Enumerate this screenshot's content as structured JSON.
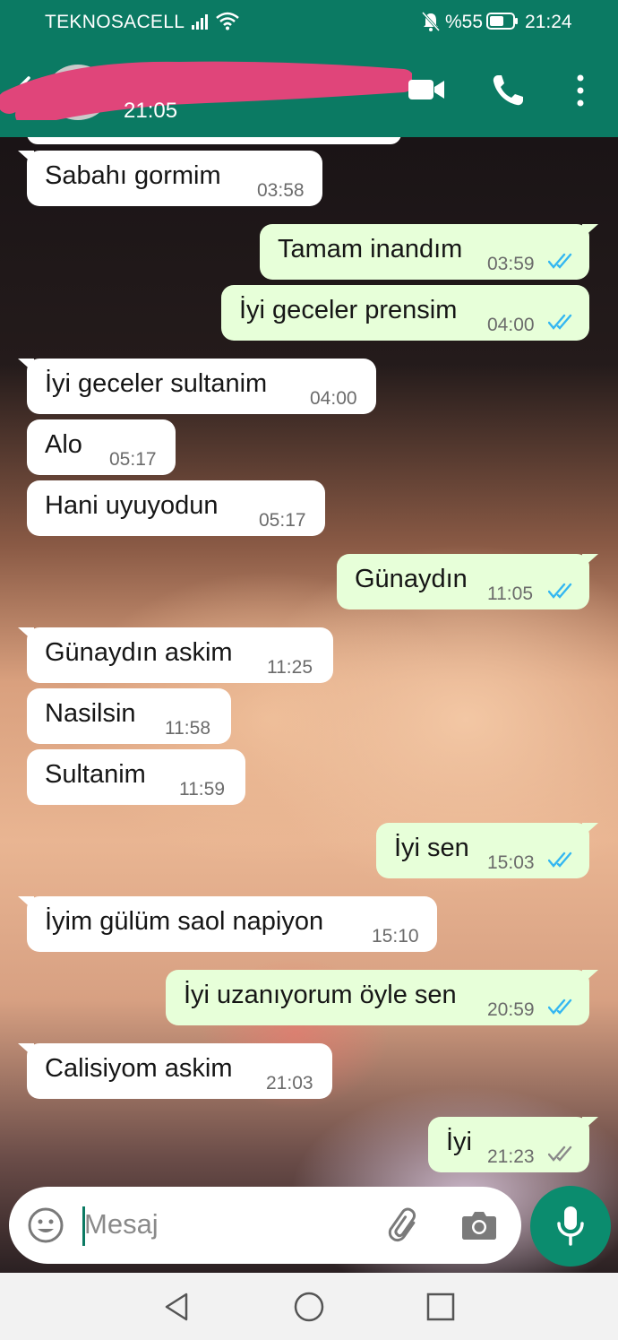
{
  "status_bar": {
    "carrier": "TEKNOSACELL",
    "battery": "%55",
    "time": "21:24"
  },
  "header": {
    "contact_name": "",
    "last_seen": "21:05"
  },
  "messages": [
    {
      "dir": "in",
      "text": "Sabahı gormim",
      "time": "03:58"
    },
    {
      "dir": "out",
      "text": "Tamam inandım",
      "time": "03:59",
      "status": "read"
    },
    {
      "dir": "out",
      "text": "İyi geceler prensim",
      "time": "04:00",
      "status": "read"
    },
    {
      "dir": "in",
      "text": "İyi geceler sultanim",
      "time": "04:00"
    },
    {
      "dir": "in",
      "text": "Alo",
      "time": "05:17"
    },
    {
      "dir": "in",
      "text": "Hani uyuyodun",
      "time": "05:17"
    },
    {
      "dir": "out",
      "text": "Günaydın",
      "time": "11:05",
      "status": "read"
    },
    {
      "dir": "in",
      "text": "Günaydın askim",
      "time": "11:25"
    },
    {
      "dir": "in",
      "text": "Nasilsin",
      "time": "11:58"
    },
    {
      "dir": "in",
      "text": "Sultanim",
      "time": "11:59"
    },
    {
      "dir": "out",
      "text": "İyi sen",
      "time": "15:03",
      "status": "read"
    },
    {
      "dir": "in",
      "text": "İyim gülüm saol napiyon",
      "time": "15:10"
    },
    {
      "dir": "out",
      "text": "İyi uzanıyorum öyle sen",
      "time": "20:59",
      "status": "read"
    },
    {
      "dir": "in",
      "text": "Calisiyom askim",
      "time": "21:03"
    },
    {
      "dir": "out",
      "text": "İyi",
      "time": "21:23",
      "status": "delivered"
    }
  ],
  "composer": {
    "placeholder": "Mesaj"
  },
  "icons": {
    "back": "back-arrow-icon",
    "video": "video-call-icon",
    "call": "phone-icon",
    "more": "more-vert-icon",
    "emoji": "emoji-icon",
    "attach": "paperclip-icon",
    "camera": "camera-icon",
    "mic": "mic-icon"
  },
  "colors": {
    "header": "#0b7a63",
    "outgoing_bubble": "#e7ffd9",
    "incoming_bubble": "#ffffff",
    "read_ticks": "#34b7f1",
    "mic_button": "#0b8c6e"
  }
}
